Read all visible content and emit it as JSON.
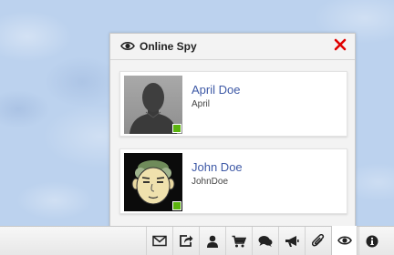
{
  "panel": {
    "title": "Online Spy",
    "title_icon": "eye-icon",
    "close_icon": "close-icon",
    "users": [
      {
        "name": "April Doe",
        "username": "April",
        "avatar": "silhouette-avatar",
        "status": "online"
      },
      {
        "name": "John Doe",
        "username": "JohnDoe",
        "avatar": "cartoon-face-avatar",
        "status": "online"
      }
    ]
  },
  "taskbar": {
    "icons": [
      "mail-icon",
      "share-icon",
      "user-icon",
      "cart-icon",
      "comments-icon",
      "megaphone-icon",
      "paperclip-icon",
      "eye-icon",
      "info-icon"
    ],
    "active": "eye-icon"
  },
  "colors": {
    "close": "#e00000",
    "link": "#3e59a6",
    "online": "#5bb30e",
    "background": "#bcd2ee"
  }
}
